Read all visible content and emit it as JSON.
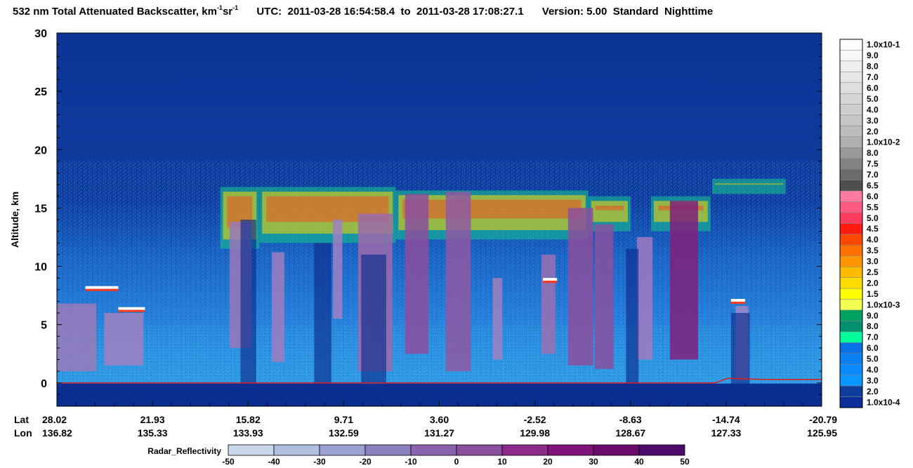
{
  "title": {
    "product": "532 nm Total Attenuated Backscatter, km",
    "unit_exp1": "-1",
    "unit_sr": " sr",
    "unit_exp2": "-1",
    "utc_label": "UTC:",
    "utc_start": "2011-03-28 16:54:58.4",
    "utc_to": "to",
    "utc_end": "2011-03-28 17:08:27.1",
    "version_label": "Version:",
    "version": "5.00",
    "standard": "Standard",
    "mode": "Nighttime"
  },
  "chart_data": {
    "type": "heatmap",
    "ylabel": "Altitude, km",
    "ylim": [
      -2,
      30
    ],
    "y_ticks": [
      "0",
      "5",
      "10",
      "15",
      "20",
      "25",
      "30"
    ],
    "y_tick_values": [
      0,
      5,
      10,
      15,
      20,
      25,
      30
    ],
    "x_row_labels": [
      "Lat",
      "Lon"
    ],
    "lat_ticks": [
      "28.02",
      "21.93",
      "15.82",
      "9.71",
      "3.60",
      "-2.52",
      "-8.63",
      "-14.74",
      "-20.79"
    ],
    "lon_ticks": [
      "136.82",
      "135.33",
      "133.93",
      "132.59",
      "131.27",
      "129.98",
      "128.67",
      "127.33",
      "125.95"
    ],
    "colorbar": {
      "labels": [
        "1.0x10-1",
        "9.0",
        "8.0",
        "7.0",
        "6.0",
        "5.0",
        "4.0",
        "3.0",
        "2.0",
        "1.0x10-2",
        "8.0",
        "7.5",
        "7.0",
        "6.5",
        "6.0",
        "5.5",
        "5.0",
        "4.5",
        "4.0",
        "3.5",
        "3.0",
        "2.5",
        "2.0",
        "1.5",
        "1.0x10-3",
        "9.0",
        "8.0",
        "7.0",
        "6.0",
        "5.0",
        "4.0",
        "3.0",
        "2.0",
        "1.0x10-4"
      ],
      "colors": [
        "#ffffff",
        "#f7f7f7",
        "#efefef",
        "#e6e6e6",
        "#dedede",
        "#d6d6d6",
        "#cecece",
        "#c6c6c6",
        "#bdbdbd",
        "#b0b0b0",
        "#999999",
        "#828282",
        "#6b6b6b",
        "#4f4f4f",
        "#ff7aa0",
        "#ff5a82",
        "#ff3a5f",
        "#ff1a10",
        "#ff4800",
        "#ff7000",
        "#ff9500",
        "#ffba00",
        "#ffdc00",
        "#ffff00",
        "#f0ff50",
        "#00a060",
        "#009070",
        "#00ff9a",
        "#0a70e6",
        "#0a80f0",
        "#0a8cff",
        "#0a96ff",
        "#0c3c9c",
        "#0a2d99"
      ]
    },
    "radar_colorbar": {
      "label": "Radar_Reflectivity",
      "ticks": [
        "-50",
        "-40",
        "-30",
        "-20",
        "-10",
        "0",
        "10",
        "20",
        "30",
        "40",
        "50"
      ],
      "colors": [
        "#c8d8ea",
        "#aebfe0",
        "#9ba2d2",
        "#8d80c0",
        "#8a62ad",
        "#8a4e9e",
        "#8c2b8a",
        "#80147a",
        "#6a0a6a",
        "#4c0a6a",
        "#3a1288"
      ]
    },
    "lidar_cloud_tops_km": [
      {
        "lat": 25.8,
        "top": 8.3
      },
      {
        "lat": 17.0,
        "top": 15.3
      },
      {
        "lat": 14.0,
        "top": 16.6
      },
      {
        "lat": 10.5,
        "top": 16.6
      },
      {
        "lat": 6.0,
        "top": 16.4
      },
      {
        "lat": 1.0,
        "top": 16.5
      },
      {
        "lat": -4.0,
        "top": 16.3
      },
      {
        "lat": -10.8,
        "top": 16.2
      },
      {
        "lat": -13.5,
        "top": 16.8
      },
      {
        "lat": -14.9,
        "top": 7.2
      },
      {
        "lat": -16.0,
        "top": 6.5
      }
    ],
    "radar_column_tops_km": [
      {
        "lat": 27.5,
        "top": 7.0
      },
      {
        "lat": 16.3,
        "top": 13.5
      },
      {
        "lat": 13.9,
        "top": 11.0
      },
      {
        "lat": 8.3,
        "top": 14.5
      },
      {
        "lat": 5.5,
        "top": 16.0
      },
      {
        "lat": 2.5,
        "top": 16.2
      },
      {
        "lat": -2.0,
        "top": 9.0
      },
      {
        "lat": -5.8,
        "top": 15.0
      },
      {
        "lat": -6.8,
        "top": 13.5
      },
      {
        "lat": -11.5,
        "top": 15.5
      },
      {
        "lat": -16.1,
        "top": 6.5
      }
    ]
  }
}
